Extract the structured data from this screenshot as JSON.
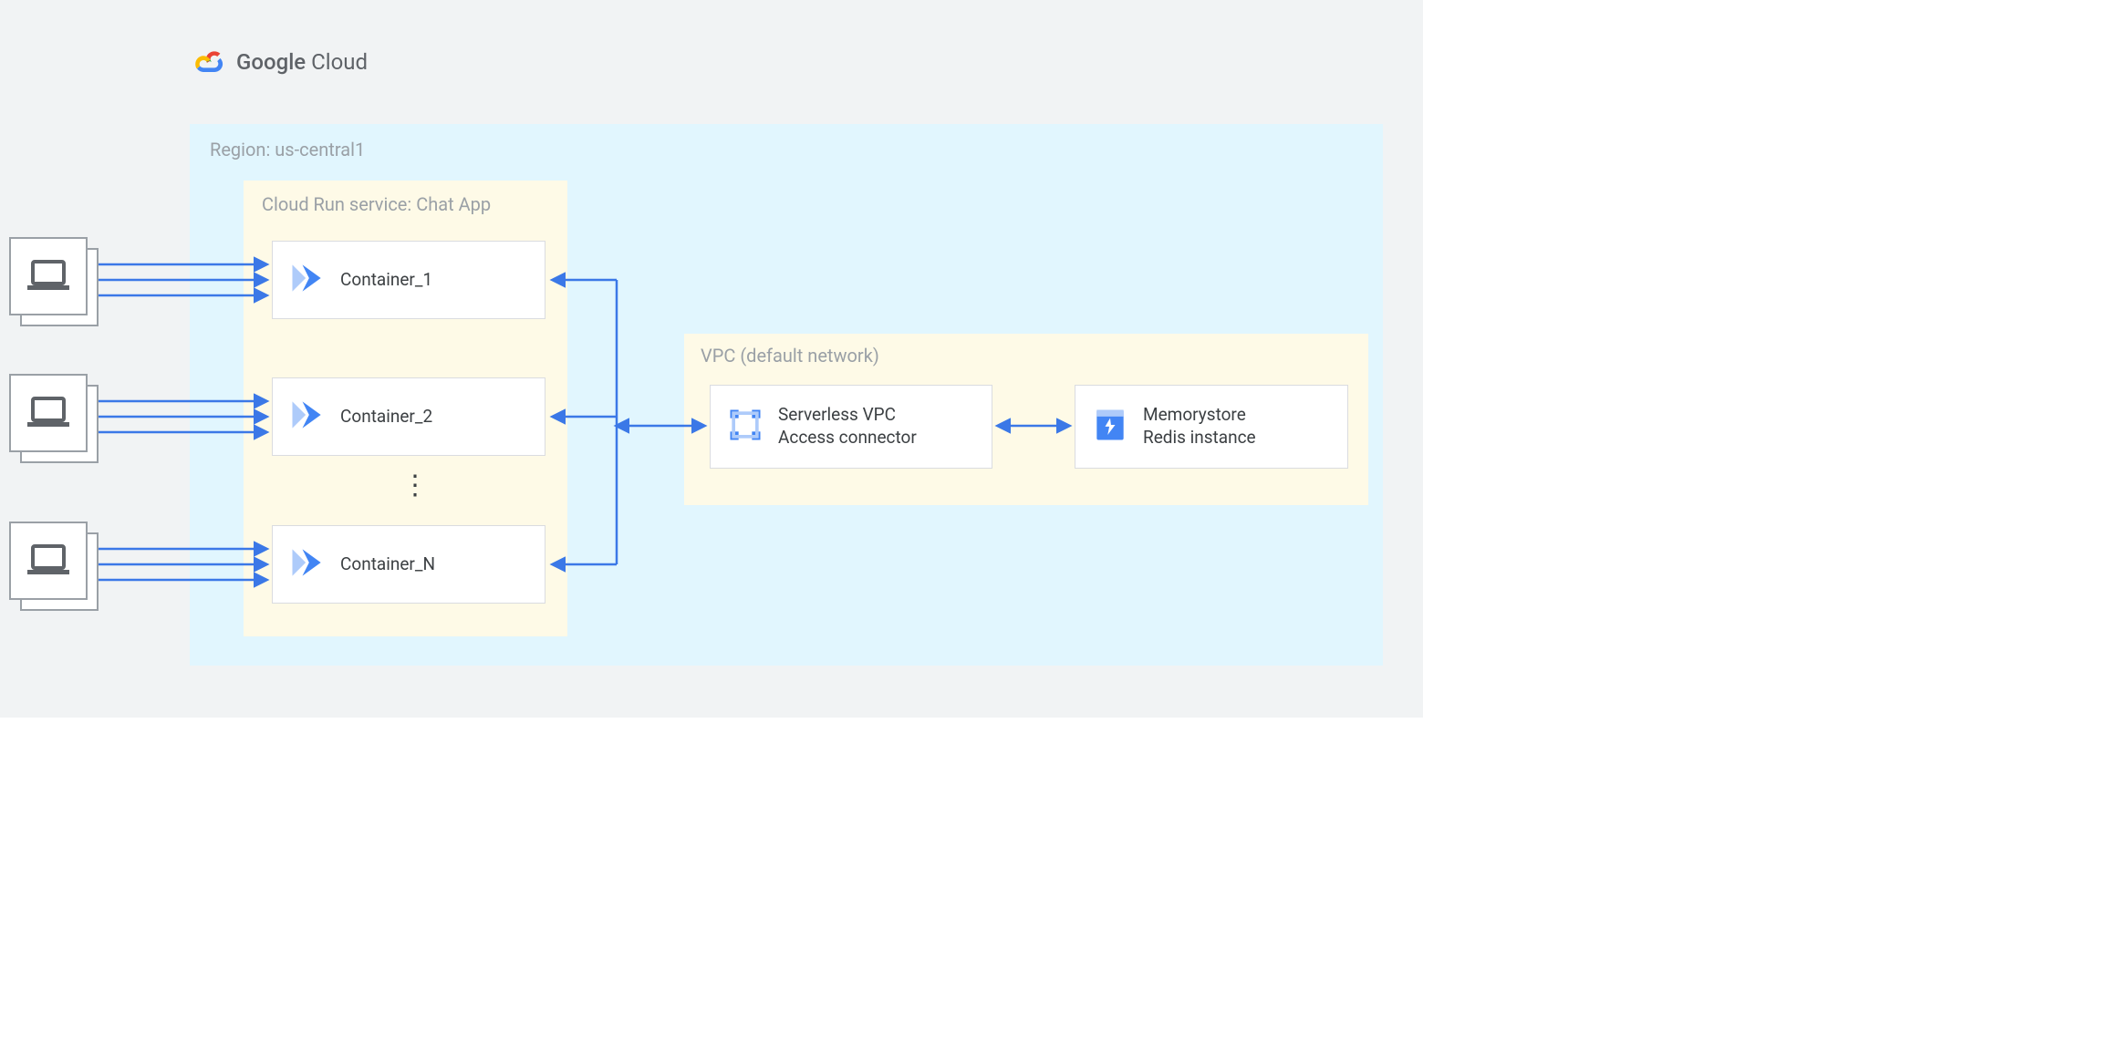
{
  "brand": {
    "name_bold": "Google",
    "name_light": "Cloud"
  },
  "region": {
    "label": "Region: us-central1"
  },
  "service": {
    "label": "Cloud Run service: Chat App"
  },
  "containers": {
    "c1": "Container_1",
    "c2": "Container_2",
    "cn": "Container_N"
  },
  "ellipsis": "⋮",
  "vpc": {
    "label": "VPC (default network)"
  },
  "connector": {
    "line1": "Serverless VPC",
    "line2": "Access connector"
  },
  "memorystore": {
    "line1": "Memorystore",
    "line2": "Redis instance"
  },
  "colors": {
    "arrow": "#3b78e7",
    "icon_primary": "#4285f4",
    "icon_light": "#aecbfa"
  }
}
